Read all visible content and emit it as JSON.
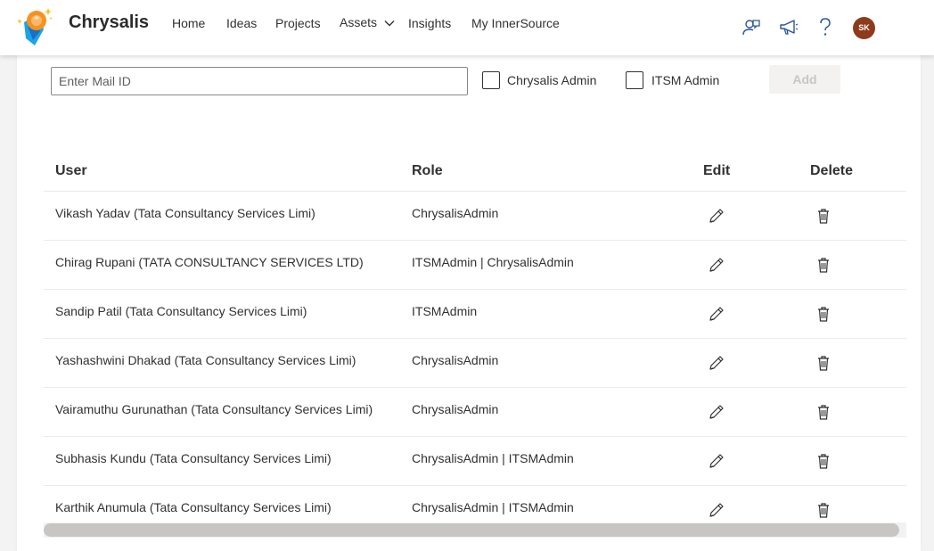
{
  "header": {
    "brand": "Chrysalis",
    "nav": {
      "home": "Home",
      "ideas": "Ideas",
      "projects": "Projects",
      "assets": "Assets",
      "insights": "Insights",
      "my_innersource": "My InnerSource"
    },
    "avatar_initials": "SK"
  },
  "form": {
    "mail_placeholder": "Enter Mail ID",
    "mail_value": "",
    "chrysalis_admin_label": "Chrysalis Admin",
    "chrysalis_admin_checked": false,
    "itsm_admin_label": "ITSM Admin",
    "itsm_admin_checked": false,
    "add_label": "Add"
  },
  "table": {
    "columns": {
      "user": "User",
      "role": "Role",
      "edit": "Edit",
      "delete": "Delete"
    },
    "rows": [
      {
        "user": "Vikash Yadav (Tata Consultancy Services Limi)",
        "role": "ChrysalisAdmin"
      },
      {
        "user": "Chirag Rupani (TATA CONSULTANCY SERVICES LTD)",
        "role": "ITSMAdmin | ChrysalisAdmin"
      },
      {
        "user": "Sandip Patil (Tata Consultancy Services Limi)",
        "role": "ITSMAdmin"
      },
      {
        "user": "Yashashwini Dhakad (Tata Consultancy Services Limi)",
        "role": "ChrysalisAdmin"
      },
      {
        "user": "Vairamuthu Gurunathan (Tata Consultancy Services Limi)",
        "role": "ChrysalisAdmin"
      },
      {
        "user": "Subhasis Kundu (Tata Consultancy Services Limi)",
        "role": "ChrysalisAdmin | ITSMAdmin"
      },
      {
        "user": "Karthik Anumula (Tata Consultancy Services Limi)",
        "role": "ChrysalisAdmin | ITSMAdmin"
      }
    ]
  },
  "icons": {
    "logo": "chrysalis-logo",
    "assets_dropdown": "chevron-down-icon",
    "feedback": "feedback-icon",
    "announcements": "megaphone-icon",
    "help": "help-icon",
    "edit": "pencil-icon",
    "delete": "trash-icon"
  },
  "colors": {
    "avatar_bg": "#8e3b1c",
    "header_icon": "#2b5797",
    "logo_orange": "#f7921e",
    "logo_blue": "#1aa3e8"
  }
}
